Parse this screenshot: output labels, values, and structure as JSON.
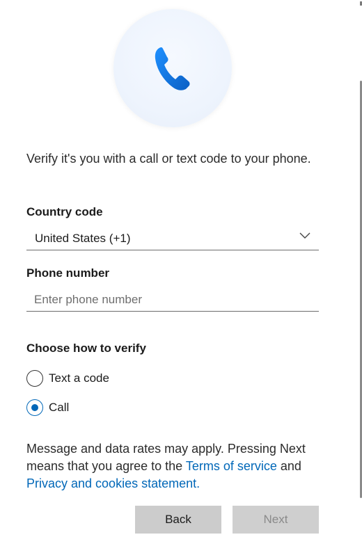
{
  "intro_text": "Verify it's you with a call or text code to your phone.",
  "country": {
    "label": "Country code",
    "selected": "United States (+1)"
  },
  "phone": {
    "label": "Phone number",
    "placeholder": "Enter phone number",
    "value": ""
  },
  "verify": {
    "heading": "Choose how to verify",
    "options": [
      {
        "label": "Text a code",
        "checked": false
      },
      {
        "label": "Call",
        "checked": true
      }
    ]
  },
  "disclaimer": {
    "text_before": "Message and data rates may apply. Pressing Next means that you agree to the ",
    "terms_link": "Terms of service",
    "text_between": " and ",
    "privacy_link": "Privacy and cookies statement."
  },
  "buttons": {
    "back": "Back",
    "next": "Next"
  },
  "colors": {
    "accent": "#0067b8",
    "button_bg": "#cccccc"
  },
  "icons": {
    "hero": "phone-handset-icon",
    "dropdown": "chevron-down-icon"
  }
}
